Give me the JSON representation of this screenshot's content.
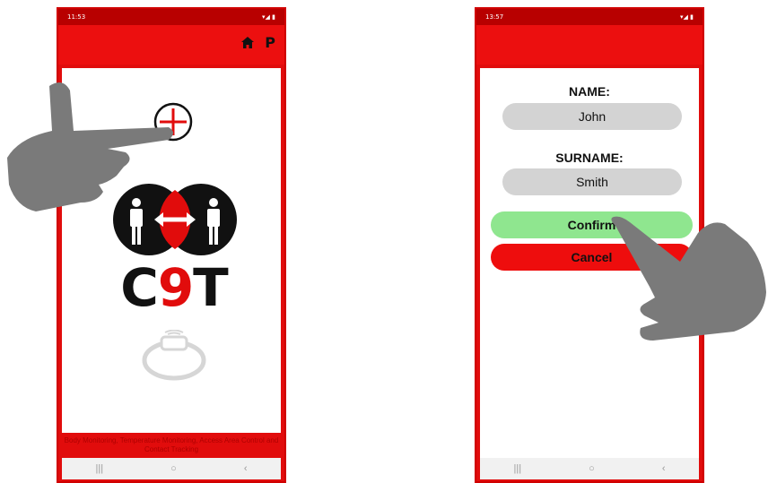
{
  "phone1": {
    "status_time": "11:53",
    "status_icons": "▾◢ ▮",
    "appbar_right_label": "P",
    "footer_text": "Body Monitoring, Temperature Monitoring, Access Area Control and Contact Tracking",
    "logo": {
      "c": "C",
      "nine": "9",
      "t": "T"
    }
  },
  "phone2": {
    "status_time": "13:57",
    "status_icons": "▾◢ ▮",
    "name_label": "NAME:",
    "name_value": "John",
    "surname_label": "SURNAME:",
    "surname_value": "Smith",
    "confirm_label": "Confirm",
    "cancel_label": "Cancel"
  },
  "navbar": {
    "recent": "|||",
    "home": "○",
    "back": "‹"
  },
  "colors": {
    "brand_red": "#e10c0c",
    "confirm_green": "#8fe68f",
    "field_gray": "#d3d3d3"
  },
  "icons": [
    "home-icon",
    "add-circle-icon",
    "people-distance-icon",
    "bracelet-icon",
    "hand-pointer-icon"
  ]
}
